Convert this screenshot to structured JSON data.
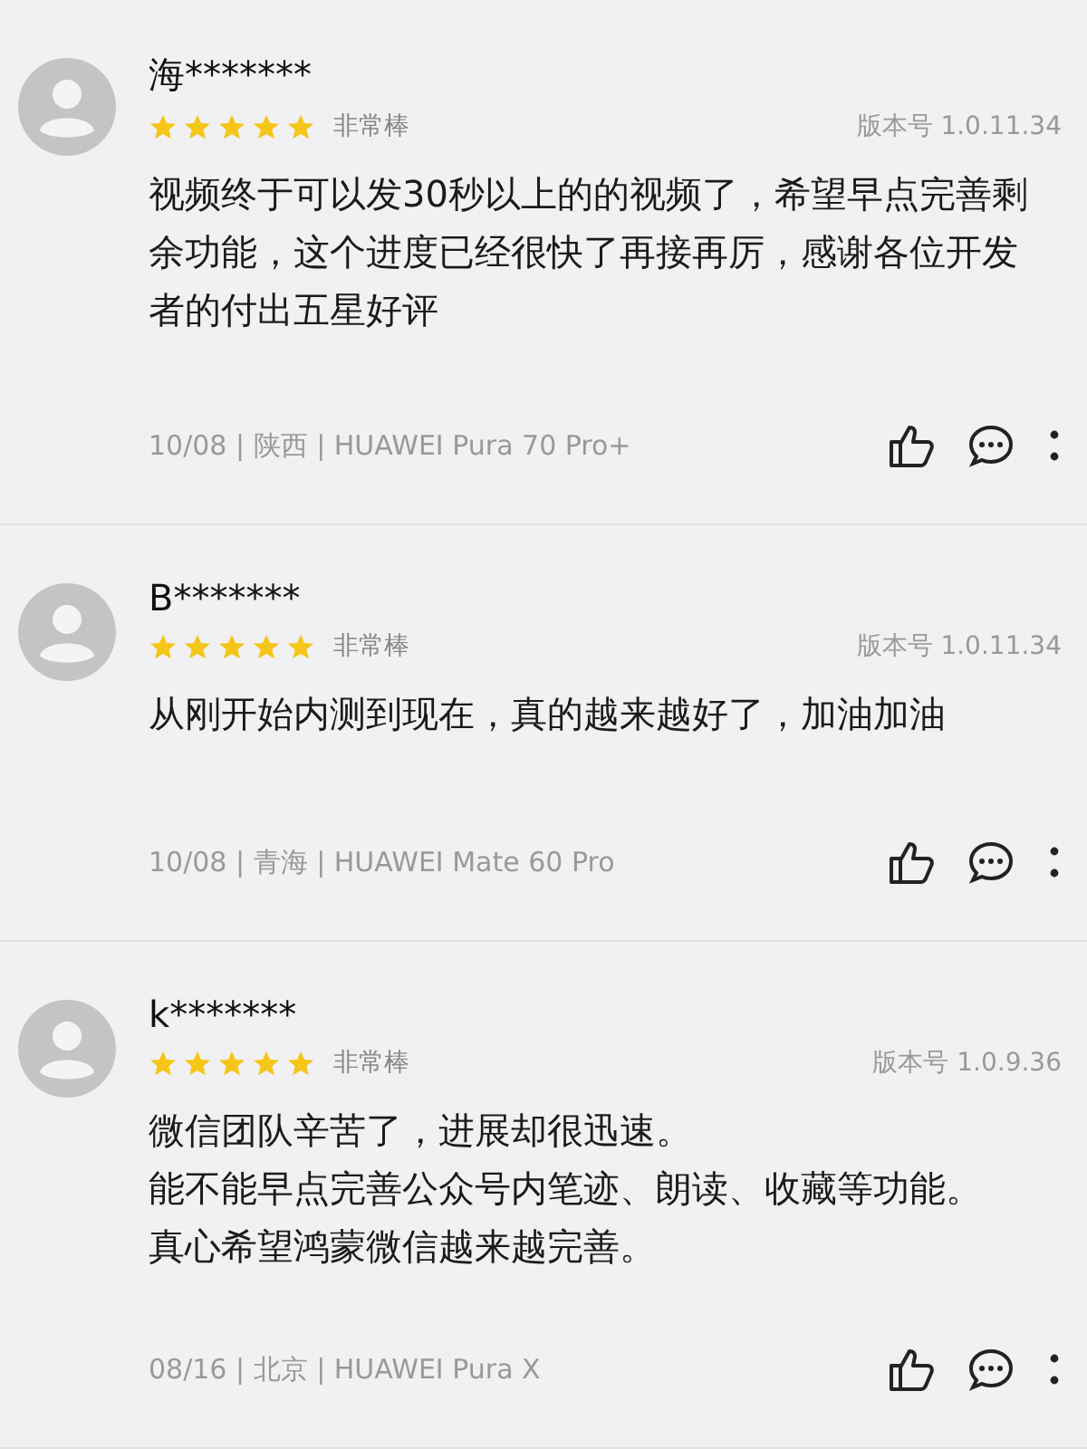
{
  "reviews": [
    {
      "user": "海*******",
      "stars": 5,
      "rating_label": "非常棒",
      "version": "版本号 1.0.11.34",
      "paragraphs": [
        "视频终于可以发30秒以上的的视频了，希望早点完善剩余功能，这个进度已经很快了再接再厉，感谢各位开发者的付出五星好评"
      ],
      "meta": "10/08 | 陕西 | HUAWEI Pura 70 Pro+"
    },
    {
      "user": "B*******",
      "stars": 5,
      "rating_label": "非常棒",
      "version": "版本号 1.0.11.34",
      "paragraphs": [
        "从刚开始内测到现在，真的越来越好了，加油加油"
      ],
      "meta": "10/08 | 青海 | HUAWEI Mate 60 Pro"
    },
    {
      "user": "k*******",
      "stars": 5,
      "rating_label": "非常棒",
      "version": "版本号 1.0.9.36",
      "paragraphs": [
        "微信团队辛苦了，进展却很迅速。",
        "能不能早点完善公众号内笔迹、朗读、收藏等功能。",
        "真心希望鸿蒙微信越来越完善。"
      ],
      "meta": "08/16 | 北京 | HUAWEI Pura X"
    }
  ]
}
